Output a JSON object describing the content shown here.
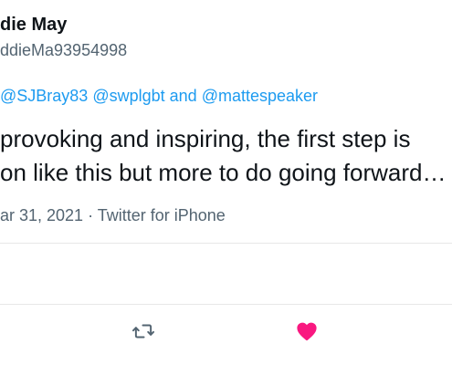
{
  "tweet": {
    "author": {
      "display_name": "die May",
      "handle": "ddieMa93954998"
    },
    "replying_to": {
      "mentions": [
        "@SJBray83",
        "@swplgbt",
        "@mattespeaker"
      ],
      "separator": " ",
      "conjunction": " and "
    },
    "text_lines": [
      "provoking and inspiring, the first step is",
      "on like this but more to do going forward…"
    ],
    "date": "ar 31, 2021",
    "meta_separator": " · ",
    "source": "Twitter for iPhone"
  },
  "actions": [
    {
      "name": "retweet",
      "icon": "retweet-icon",
      "color": "#536471"
    },
    {
      "name": "like",
      "icon": "heart-icon",
      "color": "#f91880",
      "active": true
    }
  ],
  "colors": {
    "accent": "#1d9bf0",
    "secondary_text": "#536471",
    "primary_text": "#0f1419",
    "like": "#f91880",
    "divider": "#e7e7e7"
  }
}
